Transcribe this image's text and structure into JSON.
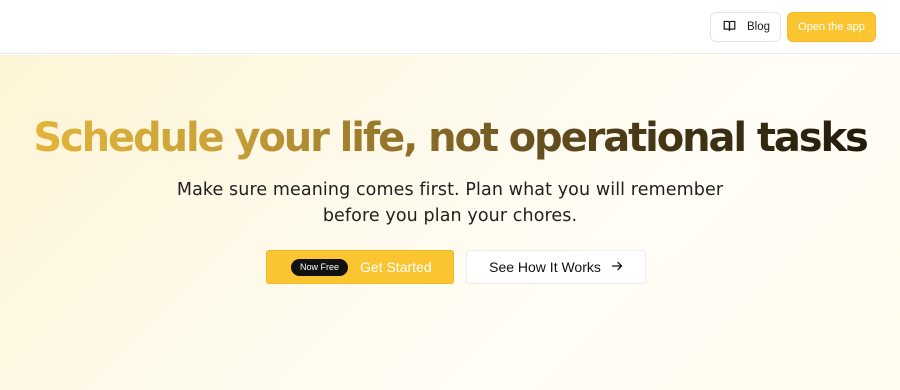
{
  "header": {
    "blog_label": "Blog",
    "blog_icon": "book-open-icon",
    "open_app_label": "Open the app"
  },
  "hero": {
    "title": "Schedule your life, not operational tasks",
    "subtitle_line1": "Make sure meaning comes first. Plan what you will remember",
    "subtitle_line2": "before you plan your chores.",
    "start_badge": "Now Free",
    "start_label": "Get Started",
    "how_label": "See How It Works",
    "how_icon": "arrow-right-icon"
  },
  "colors": {
    "accent": "#fbc531",
    "badge_bg": "#111111",
    "hero_bg": "#fdf5d6"
  }
}
